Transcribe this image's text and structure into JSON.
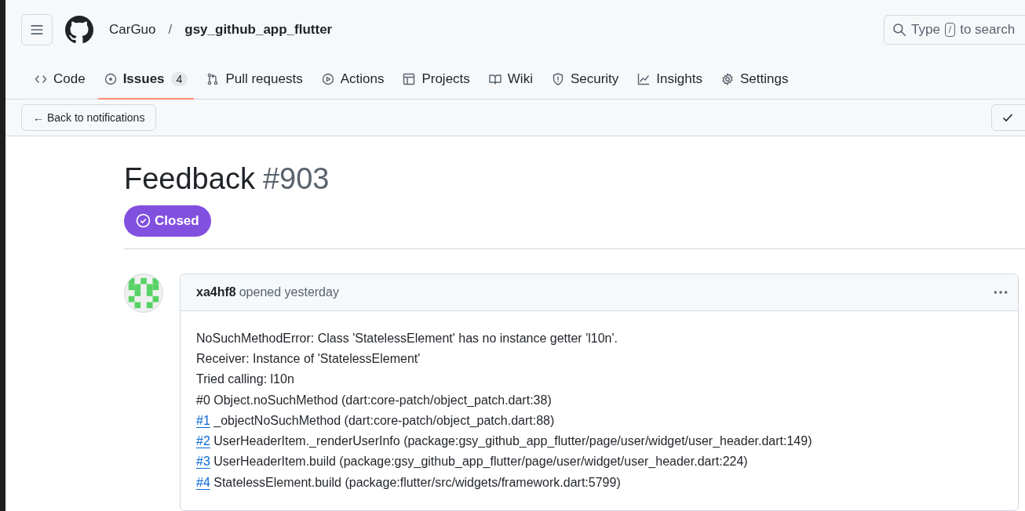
{
  "header": {
    "owner": "CarGuo",
    "separator": "/",
    "repo": "gsy_github_app_flutter",
    "search": {
      "placeholder_before": "Type",
      "key": "/",
      "placeholder_after": "to search"
    }
  },
  "tabs": [
    {
      "label": "Code",
      "selected": false
    },
    {
      "label": "Issues",
      "counter": "4",
      "selected": true
    },
    {
      "label": "Pull requests",
      "selected": false
    },
    {
      "label": "Actions",
      "selected": false
    },
    {
      "label": "Projects",
      "selected": false
    },
    {
      "label": "Wiki",
      "selected": false
    },
    {
      "label": "Security",
      "selected": false
    },
    {
      "label": "Insights",
      "selected": false
    },
    {
      "label": "Settings",
      "selected": false
    }
  ],
  "notification_bar": {
    "back_button": "← Back to notifications"
  },
  "issue": {
    "title": "Feedback",
    "number": "#903",
    "closed": true,
    "state_label": "Closed"
  },
  "comment": {
    "author": "xa4hf8",
    "action": "opened yesterday",
    "lines": [
      {
        "text": "NoSuchMethodError: Class 'StatelessElement' has no instance getter 'l10n'."
      },
      {
        "text": "Receiver: Instance of 'StatelessElement'"
      },
      {
        "text": "Tried calling: l10n"
      },
      {
        "text": "#0 Object.noSuchMethod (dart:core-patch/object_patch.dart:38)"
      },
      {
        "link": "#1",
        "text": "_objectNoSuchMethod (dart:core-patch/object_patch.dart:88)"
      },
      {
        "link": "#2",
        "text": "UserHeaderItem._renderUserInfo (package:gsy_github_app_flutter/page/user/widget/user_header.dart:149)"
      },
      {
        "link": "#3",
        "text": "UserHeaderItem.build (package:gsy_github_app_flutter/page/user/widget/user_header.dart:224)"
      },
      {
        "link": "#4",
        "text": "StatelessElement.build (package:flutter/src/widgets/framework.dart:5799)"
      }
    ]
  }
}
